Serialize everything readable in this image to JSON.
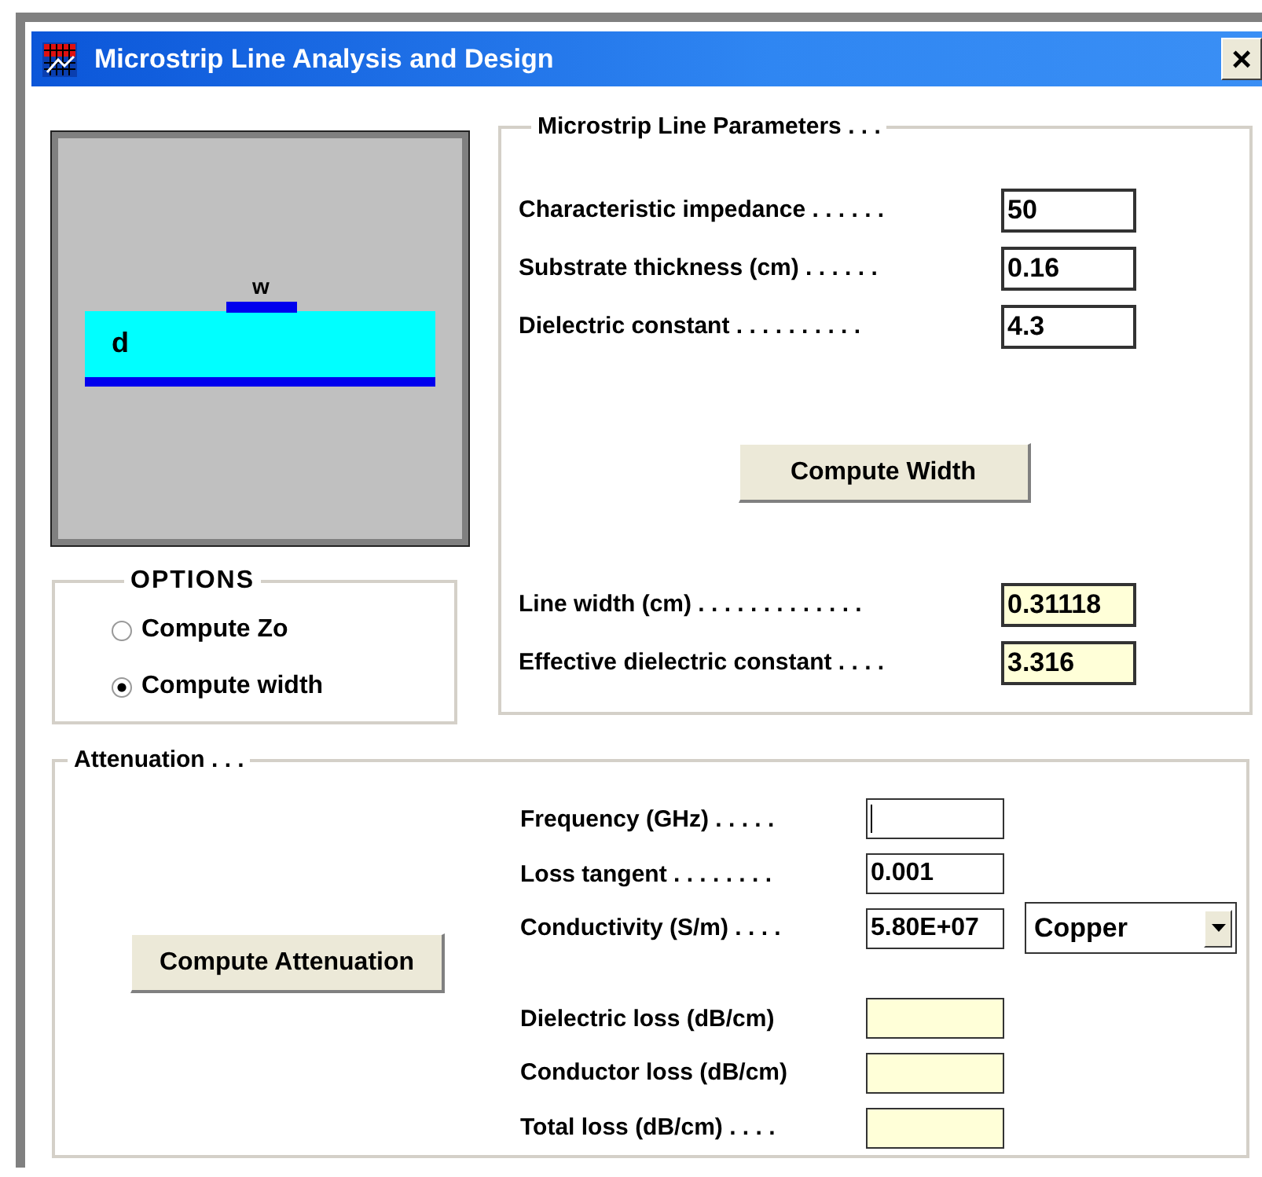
{
  "window": {
    "title": "Microstrip Line Analysis and Design",
    "close_label": "×"
  },
  "diagram": {
    "width_label": "w",
    "thickness_label": "d"
  },
  "options": {
    "title": "OPTIONS",
    "items": [
      {
        "label": "Compute Zo",
        "selected": false
      },
      {
        "label": "Compute width",
        "selected": true
      }
    ]
  },
  "parameters": {
    "title": "Microstrip Line Parameters . . .",
    "inputs": [
      {
        "label": "Characteristic impedance . . . . . .",
        "value": "50"
      },
      {
        "label": "Substrate thickness (cm) . . . . . .",
        "value": "0.16"
      },
      {
        "label": "Dielectric constant . . . . . . . . . .",
        "value": "4.3"
      }
    ],
    "button": "Compute Width",
    "outputs": [
      {
        "label": "Line width (cm) . . . . . . . . . . . . .",
        "value": "0.31118"
      },
      {
        "label": "Effective dielectric constant . . . .",
        "value": "3.316"
      }
    ]
  },
  "attenuation": {
    "title": "Attenuation . . .",
    "button": "Compute Attenuation",
    "inputs": [
      {
        "label": "Frequency (GHz) . . . . .",
        "focused": true
      },
      {
        "label": "Loss tangent . . . . . . . .",
        "value": "0.001",
        "focused": false
      },
      {
        "label": "Conductivity (S/m) . . . .",
        "value": "5.80E+07",
        "focused": false
      }
    ],
    "material": "Copper",
    "outputs": [
      {
        "label": "Dielectric loss (dB/cm)"
      },
      {
        "label": "Conductor loss (dB/cm)"
      },
      {
        "label": "Total loss (dB/cm) . . . ."
      }
    ]
  }
}
